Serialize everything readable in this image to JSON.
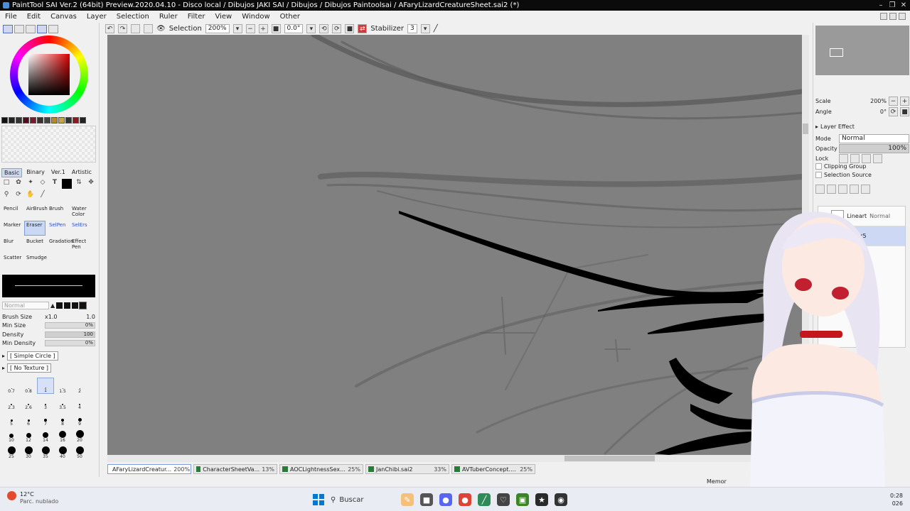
{
  "window": {
    "title": "PaintTool SAI Ver.2 (64bit) Preview.2020.04.10 - Disco local / Dibujos JAKI SAI / Dibujos / Dibujos Paintoolsai / AFaryLizardCreatureSheet.sai2 (*)"
  },
  "menu": {
    "items": [
      "File",
      "Edit",
      "Canvas",
      "Layer",
      "Selection",
      "Ruler",
      "Filter",
      "View",
      "Window",
      "Other"
    ]
  },
  "toolbar": {
    "selection_label": "Selection",
    "zoom": "200%",
    "rotation": "0.0°",
    "stabilizer_label": "Stabilizer",
    "stabilizer_value": "3"
  },
  "left_panel": {
    "tool_tabs": [
      "Basic",
      "Binary",
      "Ver.1",
      "Artistic"
    ],
    "active_tool_tab": "Basic",
    "brushes": [
      {
        "label": "Pencil",
        "selected": false
      },
      {
        "label": "AirBrush",
        "selected": false
      },
      {
        "label": "Brush",
        "selected": false
      },
      {
        "label": "Water Color",
        "selected": false
      },
      {
        "label": "Marker",
        "selected": false
      },
      {
        "label": "Eraser",
        "selected": true
      },
      {
        "label": "SelPen",
        "selected": false
      },
      {
        "label": "SelErs",
        "selected": false
      },
      {
        "label": "Blur",
        "selected": false
      },
      {
        "label": "Bucket",
        "selected": false
      },
      {
        "label": "Gradation",
        "selected": false
      },
      {
        "label": "Effect Pen",
        "selected": false
      },
      {
        "label": "Scatter",
        "selected": false
      },
      {
        "label": "Smudge",
        "selected": false
      }
    ],
    "blend_mode": "Normal",
    "brush_size_label": "Brush Size",
    "brush_size_mult": "x1.0",
    "brush_size_value": "1.0",
    "min_size_label": "Min Size",
    "min_size_value": "0%",
    "density_label": "Density",
    "density_value": "100",
    "min_density_label": "Min Density",
    "min_density_value": "0%",
    "brush_shape": "[ Simple Circle ]",
    "texture": "[ No Texture ]",
    "size_presets": [
      {
        "label": "0.7",
        "dot": 1,
        "selected": false
      },
      {
        "label": "0.8",
        "dot": 1,
        "selected": false
      },
      {
        "label": "1",
        "dot": 1,
        "selected": true
      },
      {
        "label": "1.5",
        "dot": 1,
        "selected": false
      },
      {
        "label": "2",
        "dot": 1,
        "selected": false
      },
      {
        "label": "2.3",
        "dot": 2,
        "selected": false
      },
      {
        "label": "2.6",
        "dot": 2,
        "selected": false
      },
      {
        "label": "3",
        "dot": 2,
        "selected": false
      },
      {
        "label": "3.5",
        "dot": 2,
        "selected": false
      },
      {
        "label": "4",
        "dot": 2,
        "selected": false
      },
      {
        "label": "5",
        "dot": 3,
        "selected": false
      },
      {
        "label": "6",
        "dot": 3,
        "selected": false
      },
      {
        "label": "7",
        "dot": 4,
        "selected": false
      },
      {
        "label": "8",
        "dot": 4,
        "selected": false
      },
      {
        "label": "9",
        "dot": 5,
        "selected": false
      },
      {
        "label": "10",
        "dot": 6,
        "selected": false
      },
      {
        "label": "12",
        "dot": 7,
        "selected": false
      },
      {
        "label": "14",
        "dot": 8,
        "selected": false
      },
      {
        "label": "16",
        "dot": 10,
        "selected": false
      },
      {
        "label": "20",
        "dot": 11,
        "selected": false
      },
      {
        "label": "25",
        "dot": 11,
        "selected": false
      },
      {
        "label": "30",
        "dot": 11,
        "selected": false
      },
      {
        "label": "35",
        "dot": 11,
        "selected": false
      },
      {
        "label": "40",
        "dot": 11,
        "selected": false
      },
      {
        "label": "50",
        "dot": 11,
        "selected": false
      }
    ]
  },
  "right_panel": {
    "scale_label": "Scale",
    "scale_value": "200%",
    "angle_label": "Angle",
    "angle_value": "0°",
    "layer_effect_label": "Layer Effect",
    "mode_label": "Mode",
    "mode_value": "Normal",
    "opacity_label": "Opacity",
    "opacity_value": "100%",
    "lock_label": "Lock",
    "clipping_group_label": "Clipping Group",
    "selection_source_label": "Selection Source",
    "layers": [
      {
        "name": "Lineart",
        "mode": "Normal",
        "active": false
      },
      {
        "name": "Layer5",
        "mode": "",
        "active": true
      }
    ]
  },
  "document_tabs": [
    {
      "name": "AFaryLizardCreatur...",
      "zoom": "200%",
      "active": true
    },
    {
      "name": "CharacterSheetVa...",
      "zoom": "13%",
      "active": false
    },
    {
      "name": "AOCLightnessSex...",
      "zoom": "25%",
      "active": false
    },
    {
      "name": "JanChibi.sai2",
      "zoom": "33%",
      "active": false
    },
    {
      "name": "AVTuberConcept....",
      "zoom": "25%",
      "active": false
    }
  ],
  "status": {
    "memory_label": "Memor"
  },
  "taskbar": {
    "temperature": "12°C",
    "weather": "Parc. nublado",
    "search_placeholder": "Buscar",
    "time": "0:28",
    "date": "026"
  },
  "colors": {
    "canvas_bg": "#808080",
    "selected_tab": "#c9d8f4",
    "accent": "#0078d4"
  }
}
